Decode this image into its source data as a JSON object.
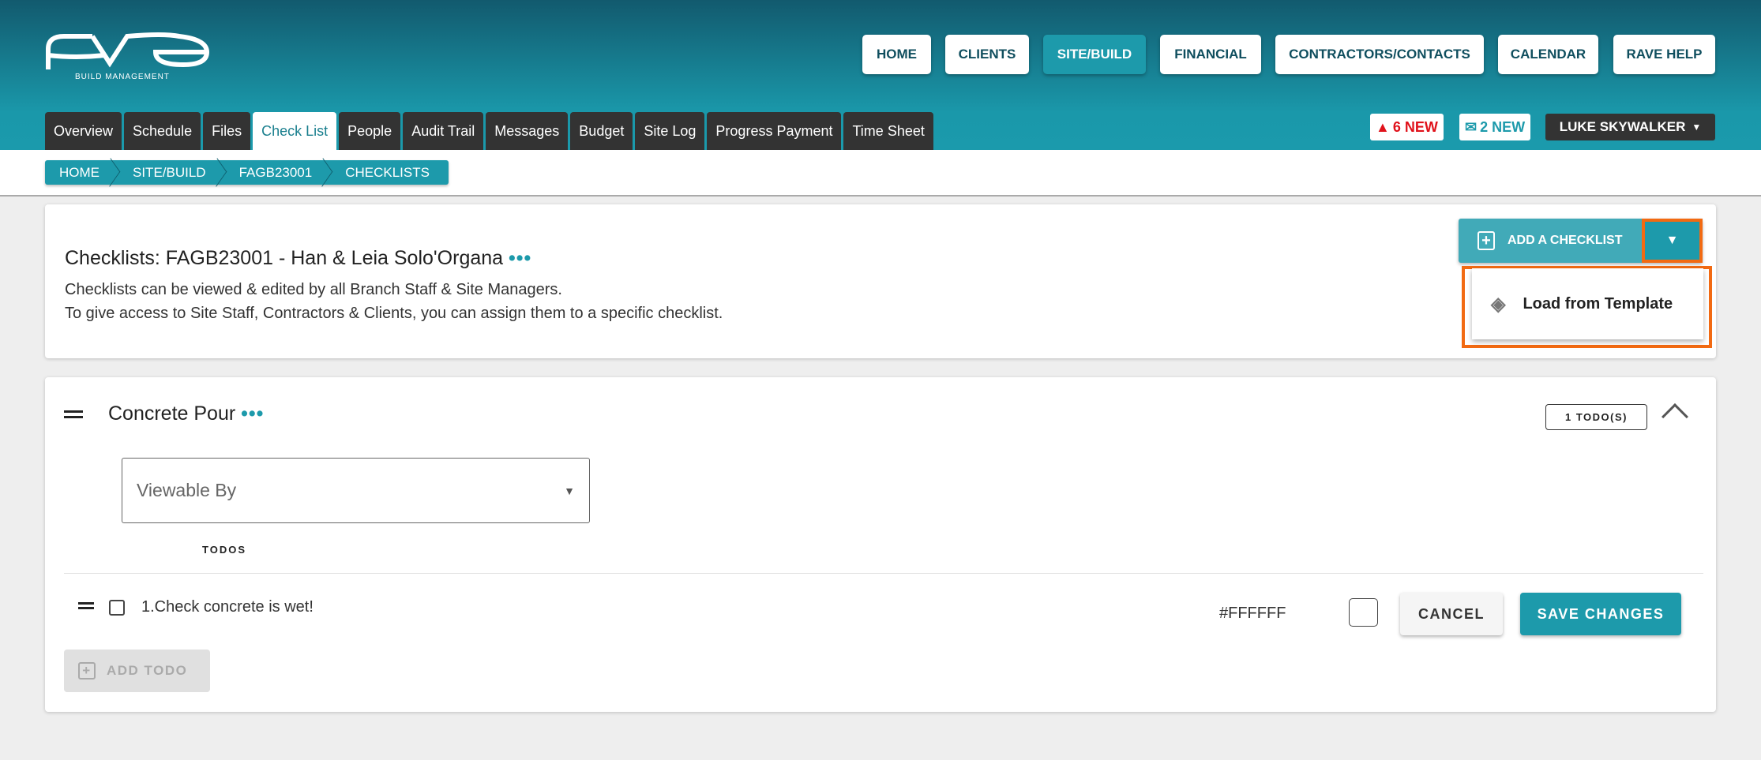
{
  "logo": {
    "text": "rave",
    "subtitle": "BUILD MANAGEMENT"
  },
  "nav": [
    {
      "label": "HOME"
    },
    {
      "label": "CLIENTS"
    },
    {
      "label": "SITE/BUILD"
    },
    {
      "label": "FINANCIAL"
    },
    {
      "label": "CONTRACTORS/CONTACTS"
    },
    {
      "label": "CALENDAR"
    },
    {
      "label": "RAVE HELP"
    }
  ],
  "tabs": [
    {
      "label": "Overview"
    },
    {
      "label": "Schedule"
    },
    {
      "label": "Files"
    },
    {
      "label": "Check List"
    },
    {
      "label": "People"
    },
    {
      "label": "Audit Trail"
    },
    {
      "label": "Messages"
    },
    {
      "label": "Budget"
    },
    {
      "label": "Site Log"
    },
    {
      "label": "Progress Payment"
    },
    {
      "label": "Time Sheet"
    }
  ],
  "alerts": {
    "warnings": "6 NEW",
    "messages": "2 NEW"
  },
  "user": {
    "name": "LUKE SKYWALKER"
  },
  "breadcrumb": [
    {
      "label": "HOME"
    },
    {
      "label": "SITE/BUILD"
    },
    {
      "label": "FAGB23001"
    },
    {
      "label": "CHECKLISTS"
    }
  ],
  "header_card": {
    "title": "Checklists: FAGB23001 - Han & Leia Solo'Organa",
    "more": "•••",
    "desc1": "Checklists can be viewed & edited by all Branch Staff & Site Managers.",
    "desc2": "To give access to Site Staff, Contractors & Clients, you can assign them to a specific checklist.",
    "add_label": "ADD A CHECKLIST",
    "menu_item": "Load from Template"
  },
  "checklist": {
    "title": "Concrete Pour",
    "more": "•••",
    "todo_count": "1 TODO(S)",
    "viewable_placeholder": "Viewable By",
    "todos_label": "TODOS",
    "todos": [
      {
        "text": "1.Check concrete is wet!"
      }
    ],
    "color_value": "#FFFFFF",
    "cancel": "CANCEL",
    "save": "SAVE CHANGES",
    "add_todo": "ADD TODO"
  },
  "colors": {
    "accent": "#1d9aab",
    "highlight": "#f26a12"
  }
}
